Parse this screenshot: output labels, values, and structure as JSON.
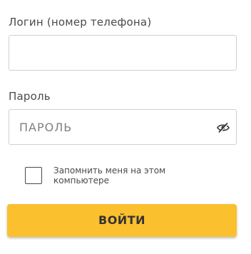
{
  "form": {
    "login_label": "Логин (номер телефона)",
    "login_value": "",
    "login_placeholder": "",
    "password_label": "Пароль",
    "password_value": "",
    "password_placeholder": "ПАРОЛЬ",
    "password_toggle_icon": "eye-slash-icon",
    "remember_label": "Запомнить меня на этом компьютере",
    "remember_checked": false,
    "submit_label": "ВОЙТИ"
  },
  "colors": {
    "accent": "#fbc02d",
    "text": "#4a4a4a",
    "border": "#cfcfcf"
  }
}
